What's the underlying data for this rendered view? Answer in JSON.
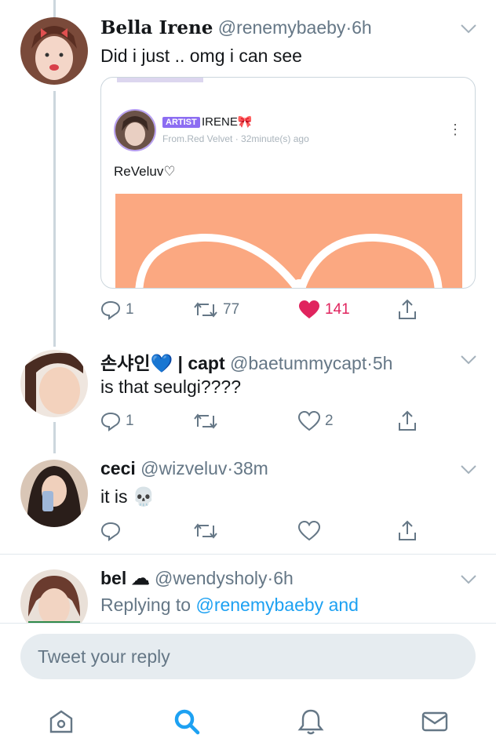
{
  "tweets": [
    {
      "name": "Bella Irene",
      "handle": "@renemybaeby",
      "dot": "·",
      "time": "6h",
      "text": "Did i just .. omg i can see",
      "replies": "1",
      "retweets": "77",
      "likes": "141",
      "liked": true,
      "quote": {
        "badge": "ARTIST",
        "author": "IRENE🎀",
        "source": "From.Red Velvet · 32minute(s) ago",
        "text": "ReVeluv♡"
      }
    },
    {
      "name": "손샤인💙 | capt",
      "handle": "@baetummycapt",
      "dot": "·",
      "time": "5h",
      "text": "is that seulgi????",
      "replies": "1",
      "retweets": "",
      "likes": "2"
    },
    {
      "name": "ceci",
      "handle": "@wizveluv",
      "dot": "·",
      "time": "38m",
      "text": "it is 💀",
      "replies": "",
      "retweets": "",
      "likes": ""
    },
    {
      "name": "bel ☁",
      "handle": "@wendysholy",
      "dot": "·",
      "time": "6h",
      "replying_prefix": "Replying to ",
      "replying_to": "@renemybaeby and"
    }
  ],
  "reply_box": {
    "placeholder": "Tweet your reply"
  },
  "tabbar": [
    "home-icon",
    "search-icon",
    "notifications-icon",
    "messages-icon"
  ],
  "colors": {
    "accent": "#1da1f2",
    "like": "#e0245e",
    "muted": "#657786"
  }
}
